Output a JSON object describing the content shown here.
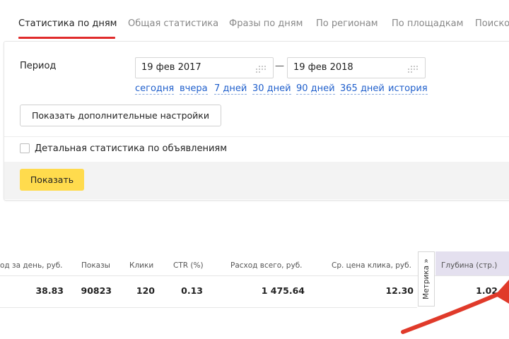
{
  "tabs": [
    {
      "label": "Статистика по дням",
      "active": true
    },
    {
      "label": "Общая статистика",
      "active": false
    },
    {
      "label": "Фразы по дням",
      "active": false
    },
    {
      "label": "По регионам",
      "active": false
    },
    {
      "label": "По площадкам",
      "active": false
    },
    {
      "label": "Поиско",
      "active": false
    }
  ],
  "period": {
    "label": "Период",
    "date_from": "19 фев 2017",
    "separator": "—",
    "date_to": "19 фев 2018",
    "quick_links": [
      "сегодня",
      "вчера",
      "7 дней",
      "30 дней",
      "90 дней",
      "365 дней",
      "история"
    ]
  },
  "buttons": {
    "more_settings": "Показать дополнительные настройки",
    "show": "Показать"
  },
  "detail_checkbox": {
    "label": "Детальная статистика по объявлениям",
    "checked": false
  },
  "table": {
    "headers": [
      "од за день, руб.",
      "Показы",
      "Клики",
      "CTR (%)",
      "Расход всего, руб.",
      "Ср. цена клика, руб.",
      "Глубина (стр.)"
    ],
    "row": [
      "38.83",
      "90823",
      "120",
      "0.13",
      "1 475.64",
      "12.30",
      "1.02"
    ],
    "metrika_label": "Метрика »"
  },
  "colors": {
    "accent_underline": "#e02b2b",
    "show_button": "#ffdb4d",
    "link": "#1f5fcc",
    "depth_header_bg": "#e4e0ef",
    "arrow": "#e03a2a"
  },
  "icons": [
    "calendar-icon",
    "calendar-icon",
    "arrow-annotation"
  ]
}
